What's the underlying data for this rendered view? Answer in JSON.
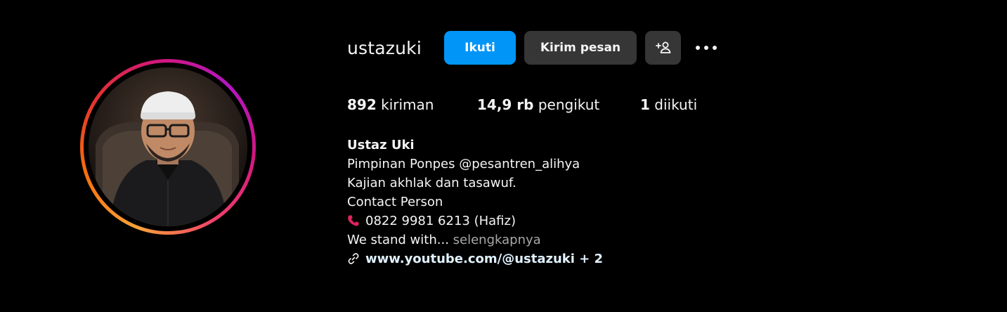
{
  "profile": {
    "username": "ustazuki",
    "buttons": {
      "follow": "Ikuti",
      "message": "Kirim pesan",
      "add_user_icon": "person-add-icon",
      "more_icon": "more-horizontal-icon"
    },
    "stats": {
      "posts_count": "892",
      "posts_label": "kiriman",
      "followers_count": "14,9 rb",
      "followers_label": "pengikut",
      "following_count": "1",
      "following_label": "diikuti"
    },
    "bio": {
      "name": "Ustaz Uki",
      "line1": "Pimpinan Ponpes @pesantren_alihya",
      "line2": "Kajian akhlak dan tasawuf.",
      "line3": "Contact Person",
      "phone_icon": "telephone-receiver-icon",
      "phone": "0822 9981 6213 (Hafiz)",
      "line5": "We stand with...",
      "more_label": "selengkapnya",
      "link_icon": "link-icon",
      "link": "www.youtube.com/@ustazuki",
      "link_extra": "+ 2"
    },
    "colors": {
      "follow_button": "#0095f6",
      "secondary_button": "#363636",
      "background": "#000000",
      "muted_text": "#a8a8a8",
      "phone_icon": "#e0245e"
    }
  }
}
